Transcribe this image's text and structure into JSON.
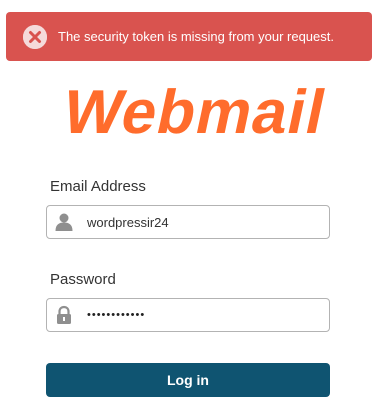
{
  "alert": {
    "message": "The security token is missing from your request.",
    "icon": "close-circle-icon",
    "color": "#d9534f"
  },
  "logo": {
    "text": "Webmail",
    "color": "#ff6c2c"
  },
  "form": {
    "email_label": "Email Address",
    "email_value": "wordpressir24",
    "email_icon": "user-icon",
    "password_label": "Password",
    "password_mask": "••••••••••••",
    "password_icon": "lock-icon",
    "login_label": "Log in",
    "button_color": "#0f5471"
  }
}
